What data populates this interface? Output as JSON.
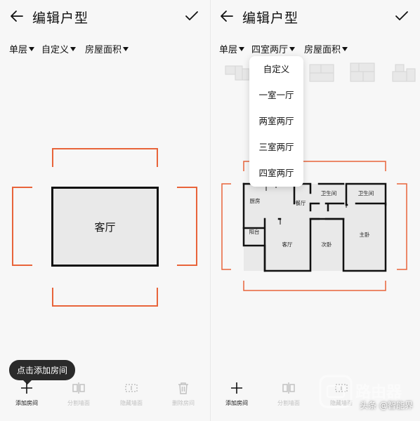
{
  "left": {
    "header": {
      "title": "编辑户型"
    },
    "filters": [
      {
        "label": "单层"
      },
      {
        "label": "自定义"
      },
      {
        "label": "房屋面积"
      }
    ],
    "canvas": {
      "room_label": "客厅"
    },
    "tooltip": "点击添加房间",
    "toolbar": [
      {
        "label": "添加房间",
        "icon": "plus-icon",
        "enabled": true
      },
      {
        "label": "分割墙面",
        "icon": "split-wall-icon",
        "enabled": false
      },
      {
        "label": "隐藏墙面",
        "icon": "hide-wall-icon",
        "enabled": false
      },
      {
        "label": "删除房间",
        "icon": "trash-icon",
        "enabled": false
      }
    ]
  },
  "right": {
    "header": {
      "title": "编辑户型"
    },
    "filters": [
      {
        "label": "单层"
      },
      {
        "label": "四室两厅"
      },
      {
        "label": "房屋面积"
      }
    ],
    "dropdown": [
      "自定义",
      "一室一厅",
      "两室两厅",
      "三室两厅",
      "四室两厅"
    ],
    "plan_rooms": {
      "kitchen": "厨房",
      "dining": "餐厅",
      "bath1": "卫生间",
      "bath2": "卫生间",
      "balcony": "阳台",
      "living": "客厅",
      "second_bedroom": "次卧",
      "master_bedroom": "主卧"
    },
    "toolbar": [
      {
        "label": "添加房间",
        "icon": "plus-icon",
        "enabled": true
      },
      {
        "label": "分割墙面",
        "icon": "split-wall-icon",
        "enabled": false
      },
      {
        "label": "隐藏墙面",
        "icon": "hide-wall-icon",
        "enabled": false
      }
    ]
  },
  "watermark": {
    "logo_text": "路由器",
    "credit": "头条 @智能界"
  },
  "colors": {
    "accent": "#e8643a",
    "wall": "#111111",
    "room_fill": "#e9e9e9",
    "tooltip_bg": "#2b2b2b",
    "disabled": "#c2c2c2"
  }
}
